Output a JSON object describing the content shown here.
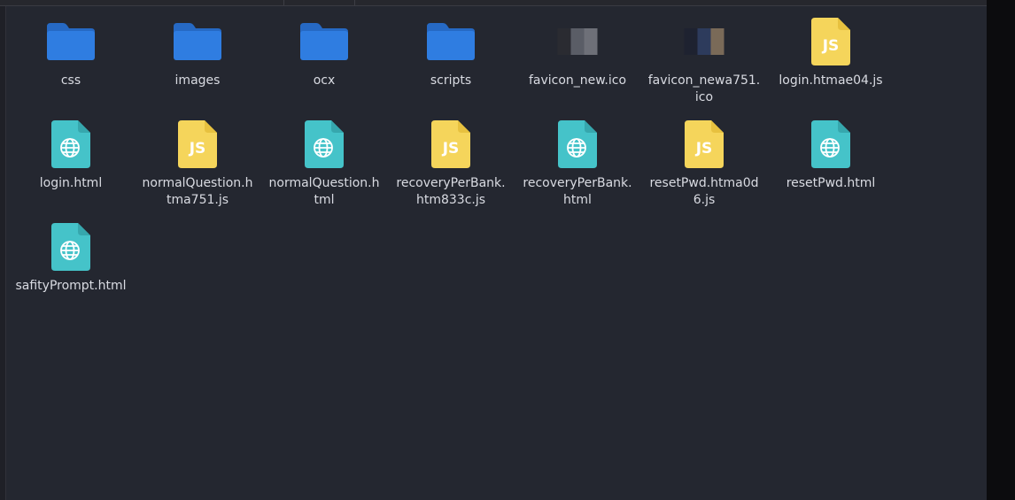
{
  "files": [
    {
      "name": "css",
      "type": "folder",
      "icon": "folder-icon"
    },
    {
      "name": "images",
      "type": "folder",
      "icon": "folder-icon"
    },
    {
      "name": "ocx",
      "type": "folder",
      "icon": "folder-icon"
    },
    {
      "name": "scripts",
      "type": "folder",
      "icon": "folder-icon"
    },
    {
      "name": "favicon_new.ico",
      "type": "ico",
      "icon": "image-thumbnail-icon"
    },
    {
      "name": "favicon_newa751.ico",
      "type": "ico",
      "icon": "image-thumbnail-icon"
    },
    {
      "name": "login.htmae04.js",
      "type": "js",
      "icon": "javascript-file-icon"
    },
    {
      "name": "login.html",
      "type": "html",
      "icon": "html-file-icon"
    },
    {
      "name": "normalQuestion.htma751.js",
      "type": "js",
      "icon": "javascript-file-icon"
    },
    {
      "name": "normalQuestion.html",
      "type": "html",
      "icon": "html-file-icon"
    },
    {
      "name": "recoveryPerBank.htm833c.js",
      "type": "js",
      "icon": "javascript-file-icon"
    },
    {
      "name": "recoveryPerBank.html",
      "type": "html",
      "icon": "html-file-icon"
    },
    {
      "name": "resetPwd.htma0d6.js",
      "type": "js",
      "icon": "javascript-file-icon"
    },
    {
      "name": "resetPwd.html",
      "type": "html",
      "icon": "html-file-icon"
    },
    {
      "name": "safityPrompt.html",
      "type": "html",
      "icon": "html-file-icon"
    }
  ],
  "colors": {
    "background": "#242730",
    "folder": "#2f7de1",
    "folder_tab": "#2669c4",
    "js": "#f5d55b",
    "html": "#45c3c9",
    "label": "#d9dbe2"
  }
}
